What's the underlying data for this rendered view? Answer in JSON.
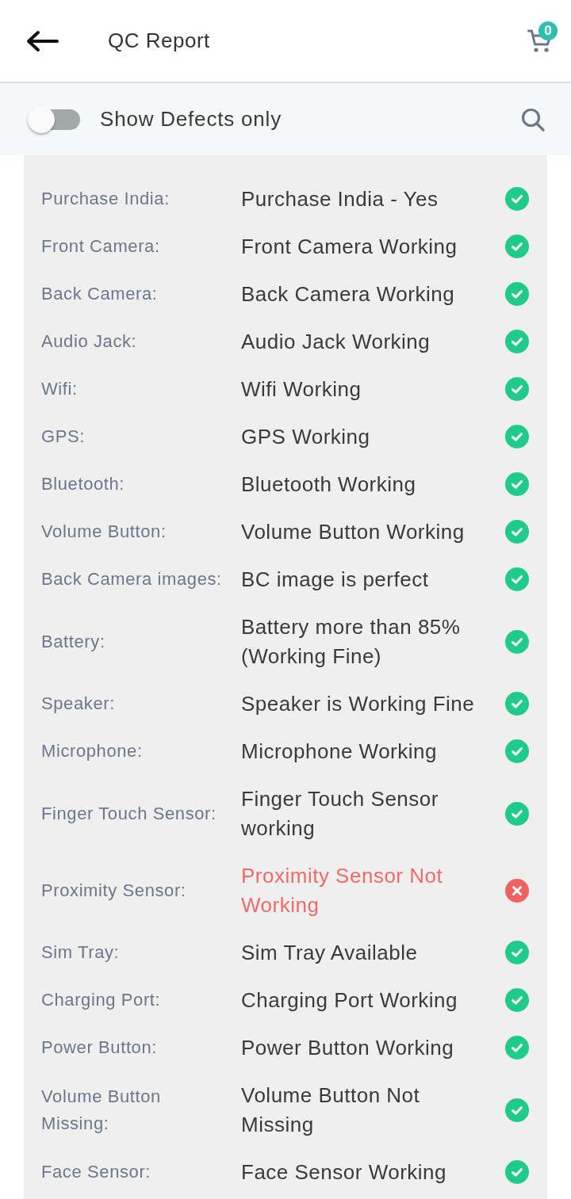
{
  "header": {
    "title": "QC Report",
    "cart_count": "0"
  },
  "filter": {
    "label": "Show Defects only",
    "on": false
  },
  "report": {
    "rows": [
      {
        "label": "Purchase India:",
        "value": "Purchase India - Yes",
        "defect": false
      },
      {
        "label": "Front Camera:",
        "value": "Front Camera Working",
        "defect": false
      },
      {
        "label": "Back Camera:",
        "value": "Back Camera Working",
        "defect": false
      },
      {
        "label": "Audio Jack:",
        "value": "Audio Jack Working",
        "defect": false
      },
      {
        "label": "Wifi:",
        "value": "Wifi Working",
        "defect": false
      },
      {
        "label": "GPS:",
        "value": "GPS Working",
        "defect": false
      },
      {
        "label": "Bluetooth:",
        "value": "Bluetooth Working",
        "defect": false
      },
      {
        "label": "Volume Button:",
        "value": "Volume Button Working",
        "defect": false
      },
      {
        "label": "Back Camera images:",
        "value": "BC image is perfect",
        "defect": false
      },
      {
        "label": "Battery:",
        "value": "Battery more than 85% (Working Fine)",
        "defect": false
      },
      {
        "label": "Speaker:",
        "value": "Speaker is Working Fine",
        "defect": false
      },
      {
        "label": "Microphone:",
        "value": "Microphone Working",
        "defect": false
      },
      {
        "label": "Finger Touch Sensor:",
        "value": "Finger Touch Sensor working",
        "defect": false
      },
      {
        "label": "Proximity Sensor:",
        "value": "Proximity Sensor Not Working",
        "defect": true
      },
      {
        "label": "Sim Tray:",
        "value": "Sim Tray Available",
        "defect": false
      },
      {
        "label": "Charging Port:",
        "value": "Charging Port Working",
        "defect": false
      },
      {
        "label": "Power Button:",
        "value": "Power Button Working",
        "defect": false
      },
      {
        "label": "Volume Button Missing:",
        "value": "Volume Button Not Missing",
        "defect": false
      },
      {
        "label": "Face Sensor:",
        "value": "Face Sensor Working",
        "defect": false
      }
    ]
  }
}
